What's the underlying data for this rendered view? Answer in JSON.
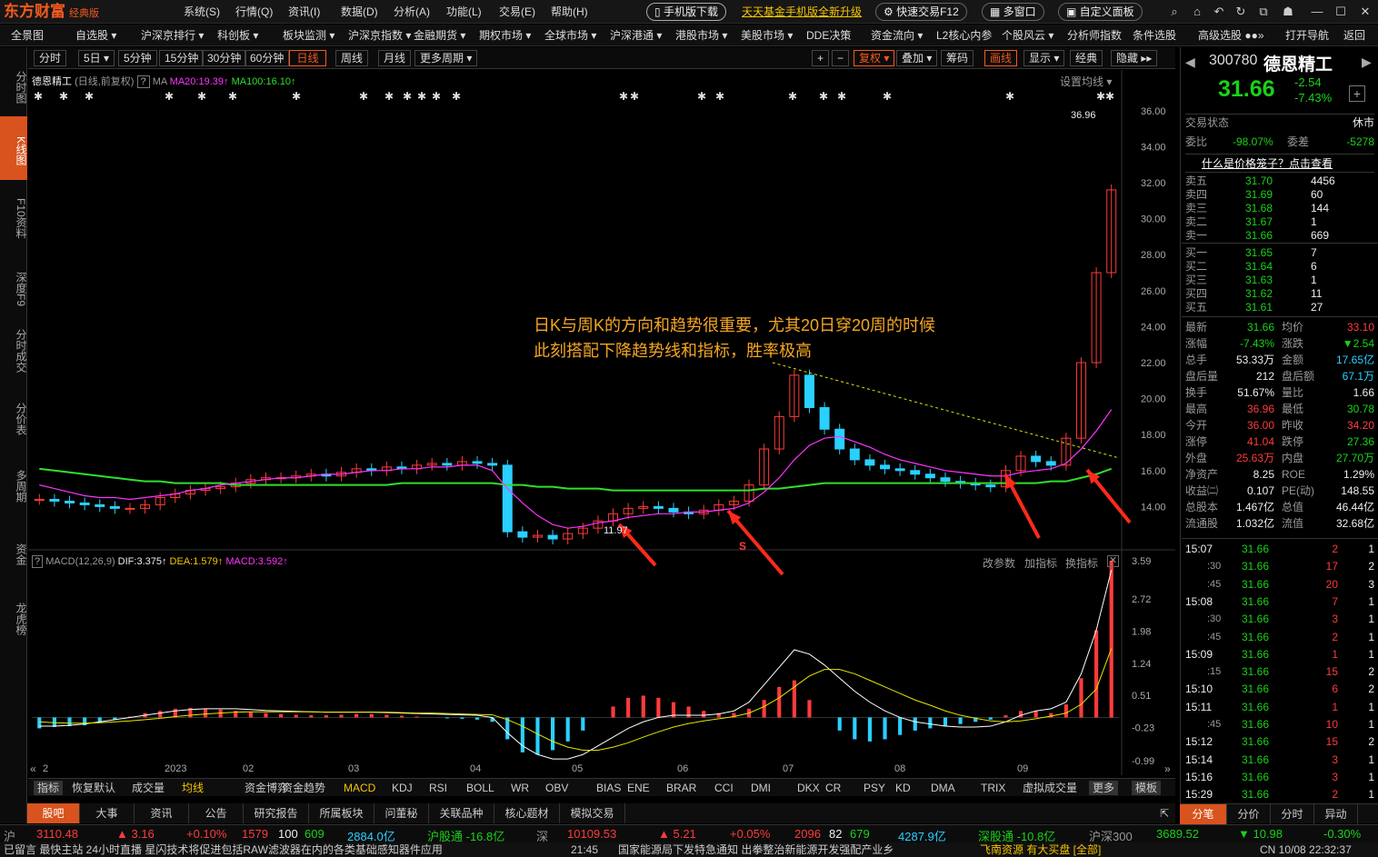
{
  "app": {
    "logo": "东方财富",
    "edition": "经典版"
  },
  "menu": [
    "系统(S)",
    "行情(Q)",
    "资讯(I)",
    "数据(D)",
    "分析(A)",
    "功能(L)",
    "交易(E)",
    "帮助(H)"
  ],
  "title_buttons": {
    "mobile": "手机版下载",
    "fund": "天天基金手机版全新升级",
    "quick_trade": "快速交易F12",
    "multi_window": "多窗口",
    "custom_panel": "自定义面板"
  },
  "nav": [
    "全景图",
    "自选股 ▾",
    "沪深京排行 ▾",
    "科创板 ▾",
    "板块监测 ▾",
    "沪深京指数 ▾",
    "金融期货 ▾",
    "期权市场 ▾",
    "全球市场 ▾",
    "沪深港通 ▾",
    "港股市场 ▾",
    "美股市场 ▾",
    "DDE决策",
    "资金流向 ▾",
    "L2核心内参",
    "个股风云 ▾",
    "分析师指数",
    "条件选股",
    "高级选股 ●●»",
    "打开导航",
    "返回"
  ],
  "left_tabs": [
    "分时图",
    "K线图",
    "F10资料",
    "深度F9",
    "分时成交",
    "分价表",
    "多周期",
    "资金",
    "龙虎榜"
  ],
  "period_tabs": [
    "分时",
    "5日 ▾",
    "5分钟",
    "15分钟",
    "30分钟",
    "60分钟",
    "日线",
    "周线",
    "月线",
    "更多周期 ▾"
  ],
  "chart_tools": [
    "+",
    "−",
    "复权 ▾",
    "叠加 ▾",
    "筹码",
    "画线",
    "显示 ▾",
    "经典",
    "隐藏 ▸▸"
  ],
  "legend": {
    "name": "德恩精工",
    "mode": "(日线,前复权)",
    "ma20": "MA20:19.39",
    "ma100": "MA100:16.10",
    "setting": "设置均线 ▾"
  },
  "annotation": [
    "日K与周K的方向和趋势很重要，尤其20日穿20周的时候",
    "此刻搭配下降趋势线和指标，胜率极高"
  ],
  "macd_legend": {
    "name": "MACD(12,26,9)",
    "dif": "DIF:3.375",
    "dea": "DEA:1.579",
    "macd": "MACD:3.592",
    "actions": [
      "改参数",
      "加指标",
      "换指标"
    ]
  },
  "price_labels": {
    "high": "36.96",
    "low": "11.97",
    "marker": "S"
  },
  "chart_data": {
    "type": "candlestick",
    "price_axis": [
      "36.00",
      "34.00",
      "32.00",
      "30.00",
      "28.00",
      "26.00",
      "24.00",
      "22.00",
      "20.00",
      "18.00",
      "16.00",
      "14.00"
    ],
    "macd_axis": [
      "3.59",
      "2.72",
      "1.98",
      "1.24",
      "0.51",
      "-0.23",
      "-0.99"
    ],
    "x_labels": [
      "2",
      "2023",
      "02",
      "03",
      "04",
      "05",
      "06",
      "07",
      "08",
      "09"
    ],
    "price_range": [
      12,
      37
    ],
    "macd_range": [
      -0.99,
      3.59
    ],
    "close": [
      14.4,
      14.3,
      14.2,
      14.1,
      14.0,
      13.9,
      13.9,
      14.1,
      14.5,
      14.7,
      14.9,
      15.0,
      15.1,
      15.3,
      15.5,
      15.6,
      15.6,
      15.7,
      15.8,
      15.7,
      15.9,
      16.1,
      16.0,
      16.2,
      16.1,
      16.3,
      16.4,
      16.3,
      16.5,
      16.4,
      16.3,
      12.6,
      12.3,
      12.4,
      12.2,
      12.5,
      12.8,
      13.2,
      13.6,
      13.9,
      14.0,
      13.9,
      13.7,
      13.6,
      13.8,
      14.1,
      14.3,
      15.2,
      17.2,
      19.0,
      21.3,
      19.5,
      18.3,
      17.2,
      16.6,
      16.3,
      16.1,
      16.0,
      15.8,
      15.6,
      15.4,
      15.3,
      15.2,
      15.1,
      16.0,
      16.8,
      16.5,
      16.3,
      17.8,
      22.0,
      27.0,
      31.6
    ],
    "ma20": [
      15.2,
      15.0,
      14.8,
      14.6,
      14.5,
      14.5,
      14.4,
      14.5,
      14.6,
      14.7,
      14.9,
      15.0,
      15.2,
      15.3,
      15.4,
      15.5,
      15.6,
      15.6,
      15.7,
      15.8,
      15.8,
      15.9,
      16.0,
      16.0,
      16.1,
      16.1,
      16.2,
      16.2,
      16.3,
      16.3,
      16.0,
      15.0,
      14.2,
      13.5,
      13.0,
      12.8,
      12.9,
      13.1,
      13.2,
      13.4,
      13.5,
      13.6,
      13.6,
      13.7,
      13.7,
      13.8,
      13.9,
      14.2,
      14.8,
      15.6,
      16.6,
      17.4,
      17.8,
      17.9,
      17.6,
      17.3,
      16.9,
      16.6,
      16.4,
      16.2,
      16.0,
      15.9,
      15.8,
      15.7,
      15.7,
      15.9,
      16.0,
      16.1,
      16.4,
      17.2,
      18.2,
      19.39
    ],
    "ma100": [
      16.1,
      16.0,
      15.9,
      15.8,
      15.7,
      15.6,
      15.5,
      15.4,
      15.4,
      15.3,
      15.3,
      15.3,
      15.3,
      15.2,
      15.2,
      15.2,
      15.2,
      15.2,
      15.2,
      15.2,
      15.2,
      15.2,
      15.2,
      15.2,
      15.3,
      15.3,
      15.3,
      15.3,
      15.3,
      15.3,
      15.3,
      15.2,
      15.2,
      15.1,
      15.1,
      15.0,
      15.0,
      15.0,
      14.9,
      14.9,
      14.9,
      14.9,
      14.9,
      14.9,
      14.9,
      14.9,
      14.9,
      14.9,
      15.0,
      15.0,
      15.1,
      15.2,
      15.3,
      15.3,
      15.3,
      15.3,
      15.3,
      15.3,
      15.3,
      15.3,
      15.3,
      15.3,
      15.3,
      15.3,
      15.3,
      15.3,
      15.3,
      15.4,
      15.4,
      15.6,
      15.8,
      16.1
    ],
    "macd_hist": [
      -0.25,
      -0.22,
      -0.2,
      -0.18,
      -0.12,
      -0.05,
      0.02,
      0.1,
      0.15,
      0.2,
      0.22,
      0.2,
      0.18,
      0.15,
      0.12,
      0.1,
      0.08,
      0.06,
      0.05,
      0.05,
      0.06,
      0.08,
      0.08,
      0.06,
      0.04,
      0.02,
      0.0,
      -0.02,
      -0.03,
      -0.05,
      -0.1,
      -0.5,
      -0.8,
      -0.85,
      -0.75,
      -0.55,
      -0.3,
      0.0,
      0.25,
      0.45,
      0.5,
      0.45,
      0.35,
      0.25,
      0.15,
      0.1,
      0.1,
      0.2,
      0.4,
      0.7,
      0.85,
      0.4,
      0.0,
      -0.3,
      -0.5,
      -0.55,
      -0.5,
      -0.4,
      -0.3,
      -0.25,
      -0.2,
      -0.15,
      -0.1,
      -0.05,
      0.05,
      0.15,
      0.15,
      0.1,
      0.3,
      0.9,
      2.0,
      3.592
    ],
    "dif": [
      -0.2,
      -0.2,
      -0.18,
      -0.15,
      -0.1,
      -0.05,
      0.0,
      0.05,
      0.1,
      0.15,
      0.18,
      0.2,
      0.2,
      0.2,
      0.18,
      0.16,
      0.15,
      0.14,
      0.13,
      0.12,
      0.12,
      0.12,
      0.12,
      0.11,
      0.1,
      0.09,
      0.08,
      0.07,
      0.06,
      0.05,
      0.0,
      -0.35,
      -0.65,
      -0.85,
      -0.95,
      -0.95,
      -0.85,
      -0.65,
      -0.45,
      -0.25,
      -0.1,
      0.0,
      0.05,
      0.05,
      0.05,
      0.08,
      0.15,
      0.35,
      0.75,
      1.15,
      1.55,
      1.45,
      1.2,
      0.9,
      0.6,
      0.35,
      0.15,
      0.0,
      -0.1,
      -0.15,
      -0.2,
      -0.22,
      -0.22,
      -0.2,
      -0.1,
      0.05,
      0.15,
      0.2,
      0.35,
      1.0,
      2.0,
      3.375
    ],
    "dea": [
      -0.1,
      -0.12,
      -0.13,
      -0.13,
      -0.12,
      -0.1,
      -0.08,
      -0.05,
      -0.02,
      0.02,
      0.05,
      0.08,
      0.1,
      0.12,
      0.13,
      0.13,
      0.13,
      0.13,
      0.13,
      0.12,
      0.12,
      0.12,
      0.12,
      0.12,
      0.11,
      0.1,
      0.1,
      0.09,
      0.08,
      0.07,
      0.06,
      -0.05,
      -0.2,
      -0.38,
      -0.55,
      -0.68,
      -0.75,
      -0.75,
      -0.68,
      -0.58,
      -0.45,
      -0.33,
      -0.22,
      -0.14,
      -0.08,
      -0.03,
      0.02,
      0.1,
      0.25,
      0.45,
      0.7,
      0.95,
      1.1,
      1.1,
      1.0,
      0.85,
      0.7,
      0.55,
      0.4,
      0.28,
      0.15,
      0.05,
      -0.02,
      -0.08,
      -0.1,
      -0.08,
      -0.03,
      0.03,
      0.1,
      0.3,
      0.65,
      1.579
    ]
  },
  "indicator_tabs": [
    "指标",
    "恢复默认",
    "成交量",
    "均线",
    "资金博弈",
    "资金趋势",
    "MACD",
    "KDJ",
    "RSI",
    "BOLL",
    "WR",
    "OBV",
    "BIAS",
    "ENE",
    "BRAR",
    "CCI",
    "DMI",
    "DKX",
    "CR",
    "PSY",
    "KD",
    "DMA",
    "TRIX",
    "虚拟成交量",
    "更多",
    "模板"
  ],
  "bottom_tabs": [
    "股吧",
    "大事",
    "资讯",
    "公告",
    "研究报告",
    "所属板块",
    "问董秘",
    "关联品种",
    "核心题材",
    "模拟交易"
  ],
  "quote": {
    "code": "300780",
    "name": "德恩精工",
    "price": "31.66",
    "change": "-2.54",
    "pct": "-7.43%",
    "state_label": "交易状态",
    "state": "休市",
    "weibi_label": "委比",
    "weibi": "-98.07%",
    "weicha_label": "委差",
    "weicha": "-5278",
    "promo": "什么是价格笼子？点击查看",
    "asks": [
      {
        "label": "卖五",
        "price": "31.70",
        "vol": "4456"
      },
      {
        "label": "卖四",
        "price": "31.69",
        "vol": "60"
      },
      {
        "label": "卖三",
        "price": "31.68",
        "vol": "144"
      },
      {
        "label": "卖二",
        "price": "31.67",
        "vol": "1"
      },
      {
        "label": "卖一",
        "price": "31.66",
        "vol": "669"
      }
    ],
    "bids": [
      {
        "label": "买一",
        "price": "31.65",
        "vol": "7"
      },
      {
        "label": "买二",
        "price": "31.64",
        "vol": "6"
      },
      {
        "label": "买三",
        "price": "31.63",
        "vol": "1"
      },
      {
        "label": "买四",
        "price": "31.62",
        "vol": "11"
      },
      {
        "label": "买五",
        "price": "31.61",
        "vol": "27"
      }
    ],
    "stats": [
      {
        "l1": "最新",
        "v1": "31.66",
        "l2": "均价",
        "v2": "33.10"
      },
      {
        "l1": "涨幅",
        "v1": "-7.43%",
        "l2": "涨跌",
        "v2": "▼2.54"
      },
      {
        "l1": "总手",
        "v1": "53.33万",
        "l2": "金额",
        "v2": "17.65亿"
      },
      {
        "l1": "盘后量",
        "v1": "212",
        "l2": "盘后额",
        "v2": "67.1万"
      },
      {
        "l1": "换手",
        "v1": "51.67%",
        "l2": "量比",
        "v2": "1.66"
      },
      {
        "l1": "最高",
        "v1": "36.96",
        "l2": "最低",
        "v2": "30.78"
      },
      {
        "l1": "今开",
        "v1": "36.00",
        "l2": "昨收",
        "v2": "34.20"
      },
      {
        "l1": "涨停",
        "v1": "41.04",
        "l2": "跌停",
        "v2": "27.36"
      },
      {
        "l1": "外盘",
        "v1": "25.63万",
        "l2": "内盘",
        "v2": "27.70万"
      },
      {
        "l1": "净资产",
        "v1": "8.25",
        "l2": "ROE",
        "v2": "1.29%"
      },
      {
        "l1": "收益㈡",
        "v1": "0.107",
        "l2": "PE(动)",
        "v2": "148.55"
      },
      {
        "l1": "总股本",
        "v1": "1.467亿",
        "l2": "总值",
        "v2": "46.44亿"
      },
      {
        "l1": "流通股",
        "v1": "1.032亿",
        "l2": "流值",
        "v2": "32.68亿"
      }
    ],
    "ticks": [
      {
        "t": "15:07",
        "p": "31.66",
        "v": "2",
        "n": "1"
      },
      {
        "t": ":30",
        "p": "31.66",
        "v": "17",
        "n": "2"
      },
      {
        "t": ":45",
        "p": "31.66",
        "v": "20",
        "n": "3"
      },
      {
        "t": "15:08",
        "p": "31.66",
        "v": "7",
        "n": "1"
      },
      {
        "t": ":30",
        "p": "31.66",
        "v": "3",
        "n": "1"
      },
      {
        "t": ":45",
        "p": "31.66",
        "v": "2",
        "n": "1"
      },
      {
        "t": "15:09",
        "p": "31.66",
        "v": "1",
        "n": "1"
      },
      {
        "t": ":15",
        "p": "31.66",
        "v": "15",
        "n": "2"
      },
      {
        "t": "15:10",
        "p": "31.66",
        "v": "6",
        "n": "2"
      },
      {
        "t": "15:11",
        "p": "31.66",
        "v": "1",
        "n": "1"
      },
      {
        "t": ":45",
        "p": "31.66",
        "v": "10",
        "n": "1"
      },
      {
        "t": "15:12",
        "p": "31.66",
        "v": "15",
        "n": "2"
      },
      {
        "t": "15:14",
        "p": "31.66",
        "v": "3",
        "n": "1"
      },
      {
        "t": "15:16",
        "p": "31.66",
        "v": "3",
        "n": "1"
      },
      {
        "t": "15:29",
        "p": "31.66",
        "v": "2",
        "n": "1"
      }
    ],
    "right_tabs": [
      "分笔",
      "分价",
      "分时",
      "异动"
    ]
  },
  "status": {
    "sh_label": "沪",
    "sh_idx": "3110.48",
    "sh_chg": "▲ 3.16",
    "sh_pct": "+0.10%",
    "sh_up": "1579",
    "sh_flat": "100",
    "sh_down": "609",
    "sh_amt": "2884.0亿",
    "sh_conn": "沪股通 -16.8亿",
    "sz_label": "深",
    "sz_idx": "10109.53",
    "sz_chg": "▲ 5.21",
    "sz_pct": "+0.05%",
    "sz_up": "2096",
    "sz_flat": "82",
    "sz_down": "679",
    "sz_amt": "4287.9亿",
    "sz_conn": "深股通 -10.8亿",
    "hs_label": "沪深300",
    "hs_idx": "3689.52",
    "hs_chg": "▼ 10.98",
    "hs_pct": "-0.30%"
  },
  "news": {
    "left": "已留言  最快主站  24小时直播  星闪技术将促进包括RAW滤波器在内的各类基础感知器件应用",
    "time": "21:45",
    "text": "国家能源局下发特急通知 出拳整治新能源开发强配产业乡",
    "right": "飞南资源 有大买盘 [全部]",
    "clock": "CN 10/08 22:32:37"
  }
}
